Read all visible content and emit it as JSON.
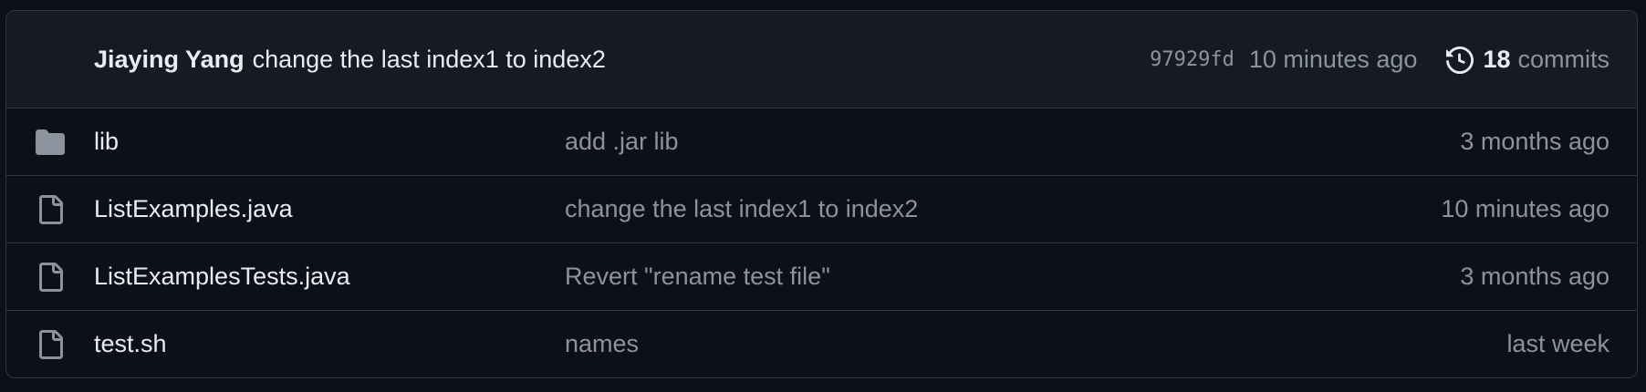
{
  "latest_commit": {
    "author": "Jiaying Yang",
    "message": "change the last index1 to index2",
    "sha": "97929fd",
    "time": "10 minutes ago",
    "commits_count": "18",
    "commits_label": "commits"
  },
  "files": [
    {
      "type": "folder",
      "icon": "folder-icon",
      "name": "lib",
      "message": "add .jar lib",
      "age": "3 months ago"
    },
    {
      "type": "file",
      "icon": "file-icon",
      "name": "ListExamples.java",
      "message": "change the last index1 to index2",
      "age": "10 minutes ago"
    },
    {
      "type": "file",
      "icon": "file-icon",
      "name": "ListExamplesTests.java",
      "message": "Revert \"rename test file\"",
      "age": "3 months ago"
    },
    {
      "type": "file",
      "icon": "file-icon",
      "name": "test.sh",
      "message": "names",
      "age": "last week"
    }
  ],
  "colors": {
    "background": "#0d1117",
    "header_bg": "#161b22",
    "border": "#30363d",
    "text_primary": "#e6edf3",
    "text_muted": "#8b949e",
    "folder_icon": "#8b949e"
  }
}
